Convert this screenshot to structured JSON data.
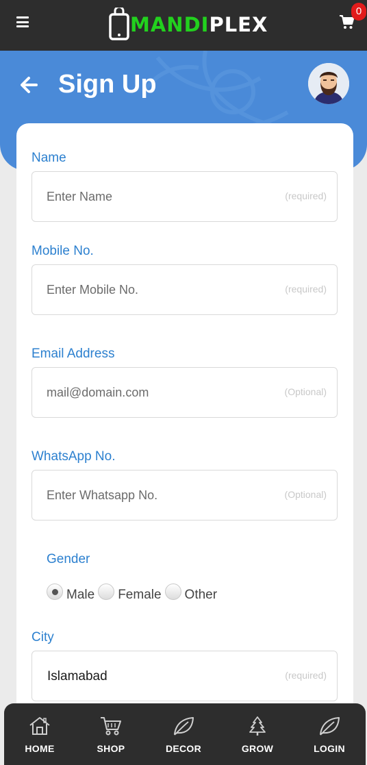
{
  "app": {
    "logo_prefix": "MANDI",
    "logo_suffix": "PLEX",
    "cart_count": "0"
  },
  "header": {
    "title": "Sign Up"
  },
  "form": {
    "name": {
      "label": "Name",
      "placeholder": "Enter Name",
      "hint": "(required)"
    },
    "mobile": {
      "label": "Mobile No.",
      "placeholder": "Enter Mobile No.",
      "hint": "(required)"
    },
    "email": {
      "label": "Email Address",
      "placeholder": "mail@domain.com",
      "hint": "(Optional)"
    },
    "whatsapp": {
      "label": "WhatsApp No.",
      "placeholder": "Enter Whatsapp No.",
      "hint": "(Optional)"
    },
    "gender": {
      "label": "Gender",
      "options": [
        "Male",
        "Female",
        "Other"
      ],
      "selected": "Male"
    },
    "city": {
      "label": "City",
      "value": "Islamabad",
      "hint": "(required)"
    }
  },
  "nav": {
    "items": [
      {
        "label": "HOME",
        "icon": "home-icon"
      },
      {
        "label": "SHOP",
        "icon": "cart-icon"
      },
      {
        "label": "DECOR",
        "icon": "leaf-icon"
      },
      {
        "label": "GROW",
        "icon": "tree-icon"
      },
      {
        "label": "LOGIN",
        "icon": "leaf-icon"
      }
    ]
  },
  "colors": {
    "topbar": "#2d2d2d",
    "header_blue": "#4a8ad8",
    "label_blue": "#2c80cf",
    "logo_green": "#22d11e",
    "badge_red": "#e21b1b"
  }
}
